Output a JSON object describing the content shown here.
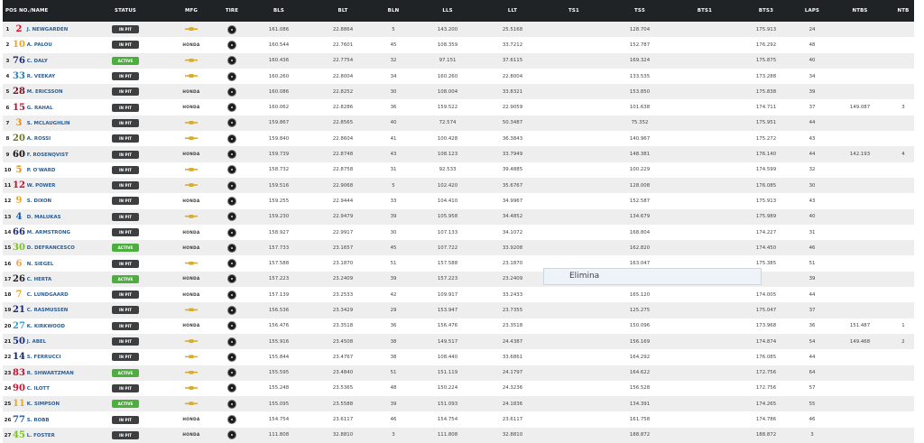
{
  "columns": [
    {
      "key": "pos_name",
      "label": "POS NO./NAME"
    },
    {
      "key": "status",
      "label": "STATUS"
    },
    {
      "key": "mfg",
      "label": "MFG"
    },
    {
      "key": "tire",
      "label": "TIRE"
    },
    {
      "key": "bls",
      "label": "BLS"
    },
    {
      "key": "blt",
      "label": "BLT"
    },
    {
      "key": "bln",
      "label": "BLN"
    },
    {
      "key": "lls",
      "label": "LLS"
    },
    {
      "key": "llt",
      "label": "LLT"
    },
    {
      "key": "ts1",
      "label": "TS1"
    },
    {
      "key": "ts5",
      "label": "TS5"
    },
    {
      "key": "bts1",
      "label": "BTS1"
    },
    {
      "key": "bts3",
      "label": "BTS3"
    },
    {
      "key": "laps",
      "label": "LAPS"
    },
    {
      "key": "ntbs",
      "label": "NTBS"
    },
    {
      "key": "ntb",
      "label": "NTB"
    }
  ],
  "car_number_colors": {
    "1": "#c8102e",
    "2": "#e9a820",
    "3": "#1a2c78",
    "4": "#2a7fb0",
    "5": "#7a1020",
    "6": "#c8102e",
    "7": "#e38c1b",
    "8": "#6b7a1e",
    "9": "#111111",
    "10": "#e38c1b",
    "11": "#c8102e",
    "12": "#e9a820",
    "13": "#1a5fa8",
    "14": "#1a2c78",
    "15": "#7bbf2a",
    "16": "#f0a35a",
    "17": "#222222",
    "18": "#e9a820",
    "19": "#1a2c78",
    "20": "#2aa7c2",
    "21": "#1a2c78",
    "22": "#0a2a6c",
    "23": "#c8102e",
    "24": "#c8102e",
    "25": "#e9a820",
    "26": "#1a5fa8",
    "27": "#7bbf2a"
  },
  "rows": [
    {
      "pos": "1",
      "num": "2",
      "name": "J. NEWGARDEN",
      "status": "IN PIT",
      "mfg": "chevrolet",
      "bls": "161.086",
      "blt": "22.8864",
      "bln": "5",
      "lls": "143.200",
      "llt": "25.5168",
      "ts1": "",
      "ts5": "128.704",
      "bts1": "",
      "bts3": "175.913",
      "laps": "24",
      "ntbs": "",
      "ntb": ""
    },
    {
      "pos": "2",
      "num": "10",
      "name": "A. PALOU",
      "status": "IN PIT",
      "mfg": "HONDA",
      "bls": "160.544",
      "blt": "22.7601",
      "bln": "45",
      "lls": "108.359",
      "llt": "33.7212",
      "ts1": "",
      "ts5": "152.787",
      "bts1": "",
      "bts3": "176.292",
      "laps": "48",
      "ntbs": "",
      "ntb": ""
    },
    {
      "pos": "3",
      "num": "76",
      "name": "C. DALY",
      "status": "ACTIVE",
      "mfg": "chevrolet",
      "bls": "160.436",
      "blt": "22.7754",
      "bln": "32",
      "lls": "97.151",
      "llt": "37.6115",
      "ts1": "",
      "ts5": "169.324",
      "bts1": "",
      "bts3": "175.875",
      "laps": "40",
      "ntbs": "",
      "ntb": ""
    },
    {
      "pos": "4",
      "num": "33",
      "name": "R. VEEKAY",
      "status": "IN PIT",
      "mfg": "chevrolet",
      "bls": "160.260",
      "blt": "22.8004",
      "bln": "34",
      "lls": "160.260",
      "llt": "22.8004",
      "ts1": "",
      "ts5": "133.535",
      "bts1": "",
      "bts3": "173.288",
      "laps": "34",
      "ntbs": "",
      "ntb": ""
    },
    {
      "pos": "5",
      "num": "28",
      "name": "M. ERICSSON",
      "status": "IN PIT",
      "mfg": "HONDA",
      "bls": "160.086",
      "blt": "22.8252",
      "bln": "30",
      "lls": "108.004",
      "llt": "33.8321",
      "ts1": "",
      "ts5": "153.850",
      "bts1": "",
      "bts3": "175.838",
      "laps": "39",
      "ntbs": "",
      "ntb": ""
    },
    {
      "pos": "6",
      "num": "15",
      "name": "G. RAHAL",
      "status": "IN PIT",
      "mfg": "HONDA",
      "bls": "160.062",
      "blt": "22.8286",
      "bln": "36",
      "lls": "159.522",
      "llt": "22.9059",
      "ts1": "",
      "ts5": "101.638",
      "bts1": "",
      "bts3": "174.711",
      "laps": "37",
      "ntbs": "149.087",
      "ntb": "3"
    },
    {
      "pos": "7",
      "num": "3",
      "name": "S. MCLAUGHLIN",
      "status": "IN PIT",
      "mfg": "chevrolet",
      "bls": "159.867",
      "blt": "22.8565",
      "bln": "40",
      "lls": "72.574",
      "llt": "50.3487",
      "ts1": "",
      "ts5": "75.352",
      "bts1": "",
      "bts3": "175.951",
      "laps": "44",
      "ntbs": "",
      "ntb": ""
    },
    {
      "pos": "8",
      "num": "20",
      "name": "A. ROSSI",
      "status": "IN PIT",
      "mfg": "chevrolet",
      "bls": "159.840",
      "blt": "22.8604",
      "bln": "41",
      "lls": "100.428",
      "llt": "36.3843",
      "ts1": "",
      "ts5": "140.967",
      "bts1": "",
      "bts3": "175.272",
      "laps": "43",
      "ntbs": "",
      "ntb": ""
    },
    {
      "pos": "9",
      "num": "60",
      "name": "F. ROSENQVIST",
      "status": "IN PIT",
      "mfg": "HONDA",
      "bls": "159.739",
      "blt": "22.8748",
      "bln": "43",
      "lls": "108.123",
      "llt": "33.7949",
      "ts1": "",
      "ts5": "148.381",
      "bts1": "",
      "bts3": "176.140",
      "laps": "44",
      "ntbs": "142.193",
      "ntb": "4"
    },
    {
      "pos": "10",
      "num": "5",
      "name": "P. O'WARD",
      "status": "IN PIT",
      "mfg": "chevrolet",
      "bls": "158.732",
      "blt": "22.8758",
      "bln": "31",
      "lls": "92.533",
      "llt": "39.4885",
      "ts1": "",
      "ts5": "100.229",
      "bts1": "",
      "bts3": "174.599",
      "laps": "32",
      "ntbs": "",
      "ntb": ""
    },
    {
      "pos": "11",
      "num": "12",
      "name": "W. POWER",
      "status": "IN PIT",
      "mfg": "chevrolet",
      "bls": "159.516",
      "blt": "22.9068",
      "bln": "5",
      "lls": "102.420",
      "llt": "35.6767",
      "ts1": "",
      "ts5": "128.008",
      "bts1": "",
      "bts3": "176.085",
      "laps": "30",
      "ntbs": "",
      "ntb": ""
    },
    {
      "pos": "12",
      "num": "9",
      "name": "S. DIXON",
      "status": "IN PIT",
      "mfg": "HONDA",
      "bls": "159.255",
      "blt": "22.9444",
      "bln": "33",
      "lls": "104.410",
      "llt": "34.9967",
      "ts1": "",
      "ts5": "152.587",
      "bts1": "",
      "bts3": "175.913",
      "laps": "43",
      "ntbs": "",
      "ntb": ""
    },
    {
      "pos": "13",
      "num": "4",
      "name": "D. MALUKAS",
      "status": "IN PIT",
      "mfg": "chevrolet",
      "bls": "159.230",
      "blt": "22.9479",
      "bln": "39",
      "lls": "105.958",
      "llt": "34.4852",
      "ts1": "",
      "ts5": "134.679",
      "bts1": "",
      "bts3": "175.989",
      "laps": "40",
      "ntbs": "",
      "ntb": ""
    },
    {
      "pos": "14",
      "num": "66",
      "name": "M. ARMSTRONG",
      "status": "IN PIT",
      "mfg": "HONDA",
      "bls": "158.927",
      "blt": "22.9917",
      "bln": "30",
      "lls": "107.133",
      "llt": "34.1072",
      "ts1": "",
      "ts5": "168.804",
      "bts1": "",
      "bts3": "174.227",
      "laps": "31",
      "ntbs": "",
      "ntb": ""
    },
    {
      "pos": "15",
      "num": "30",
      "name": "D. DEFRANCESCO",
      "status": "ACTIVE",
      "mfg": "HONDA",
      "bls": "157.733",
      "blt": "23.1657",
      "bln": "45",
      "lls": "107.722",
      "llt": "33.9208",
      "ts1": "",
      "ts5": "162.820",
      "bts1": "",
      "bts3": "174.450",
      "laps": "46",
      "ntbs": "",
      "ntb": ""
    },
    {
      "pos": "16",
      "num": "6",
      "name": "N. SIEGEL",
      "status": "IN PIT",
      "mfg": "chevrolet",
      "bls": "157.588",
      "blt": "23.1870",
      "bln": "51",
      "lls": "157.588",
      "llt": "23.1870",
      "ts1": "",
      "ts5": "163.047",
      "bts1": "",
      "bts3": "175.385",
      "laps": "51",
      "ntbs": "",
      "ntb": ""
    },
    {
      "pos": "17",
      "num": "26",
      "name": "C. HERTA",
      "status": "ACTIVE",
      "mfg": "HONDA",
      "bls": "157.223",
      "blt": "23.2409",
      "bln": "39",
      "lls": "157.223",
      "llt": "23.2409",
      "ts1": "",
      "ts5": "",
      "bts1": "",
      "bts3": "",
      "laps": "39",
      "ntbs": "",
      "ntb": ""
    },
    {
      "pos": "18",
      "num": "7",
      "name": "C. LUNDGAARD",
      "status": "IN PIT",
      "mfg": "HONDA",
      "bls": "157.139",
      "blt": "23.2533",
      "bln": "42",
      "lls": "109.917",
      "llt": "33.2433",
      "ts1": "",
      "ts5": "165.120",
      "bts1": "",
      "bts3": "174.005",
      "laps": "44",
      "ntbs": "",
      "ntb": ""
    },
    {
      "pos": "19",
      "num": "21",
      "name": "C. RASMUSSEN",
      "status": "IN PIT",
      "mfg": "chevrolet",
      "bls": "156.536",
      "blt": "23.3429",
      "bln": "29",
      "lls": "153.947",
      "llt": "23.7355",
      "ts1": "",
      "ts5": "125.275",
      "bts1": "",
      "bts3": "175.047",
      "laps": "37",
      "ntbs": "",
      "ntb": ""
    },
    {
      "pos": "20",
      "num": "27",
      "name": "K. KIRKWOOD",
      "status": "IN PIT",
      "mfg": "HONDA",
      "bls": "156.476",
      "blt": "23.3518",
      "bln": "36",
      "lls": "156.476",
      "llt": "23.3518",
      "ts1": "",
      "ts5": "150.096",
      "bts1": "",
      "bts3": "173.968",
      "laps": "36",
      "ntbs": "151.487",
      "ntb": "1"
    },
    {
      "pos": "21",
      "num": "50",
      "name": "J. ABEL",
      "status": "IN PIT",
      "mfg": "chevrolet",
      "bls": "155.916",
      "blt": "23.4508",
      "bln": "38",
      "lls": "149.517",
      "llt": "24.4387",
      "ts1": "",
      "ts5": "156.169",
      "bts1": "",
      "bts3": "174.874",
      "laps": "54",
      "ntbs": "149.468",
      "ntb": "2"
    },
    {
      "pos": "22",
      "num": "14",
      "name": "S. FERRUCCI",
      "status": "IN PIT",
      "mfg": "chevrolet",
      "bls": "155.844",
      "blt": "23.4767",
      "bln": "38",
      "lls": "108.440",
      "llt": "33.6861",
      "ts1": "",
      "ts5": "164.292",
      "bts1": "",
      "bts3": "176.085",
      "laps": "44",
      "ntbs": "",
      "ntb": ""
    },
    {
      "pos": "23",
      "num": "83",
      "name": "R. SHWARTZMAN",
      "status": "ACTIVE",
      "mfg": "chevrolet",
      "bls": "155.595",
      "blt": "23.4840",
      "bln": "51",
      "lls": "151.119",
      "llt": "24.1797",
      "ts1": "",
      "ts5": "164.622",
      "bts1": "",
      "bts3": "172.756",
      "laps": "64",
      "ntbs": "",
      "ntb": ""
    },
    {
      "pos": "24",
      "num": "90",
      "name": "C. ILOTT",
      "status": "IN PIT",
      "mfg": "chevrolet",
      "bls": "155.248",
      "blt": "23.5365",
      "bln": "48",
      "lls": "150.224",
      "llt": "24.3236",
      "ts1": "",
      "ts5": "156.528",
      "bts1": "",
      "bts3": "172.756",
      "laps": "57",
      "ntbs": "",
      "ntb": ""
    },
    {
      "pos": "25",
      "num": "11",
      "name": "K. SIMPSON",
      "status": "ACTIVE",
      "mfg": "chevrolet",
      "bls": "155.095",
      "blt": "23.5588",
      "bln": "39",
      "lls": "151.093",
      "llt": "24.1836",
      "ts1": "",
      "ts5": "134.391",
      "bts1": "",
      "bts3": "174.265",
      "laps": "55",
      "ntbs": "",
      "ntb": ""
    },
    {
      "pos": "26",
      "num": "77",
      "name": "S. ROBB",
      "status": "IN PIT",
      "mfg": "HONDA",
      "bls": "154.754",
      "blt": "23.6117",
      "bln": "46",
      "lls": "154.754",
      "llt": "23.6117",
      "ts1": "",
      "ts5": "161.758",
      "bts1": "",
      "bts3": "174.786",
      "laps": "46",
      "ntbs": "",
      "ntb": ""
    },
    {
      "pos": "27",
      "num": "45",
      "name": "L. FOSTER",
      "status": "IN PIT",
      "mfg": "HONDA",
      "bls": "111.808",
      "blt": "32.8810",
      "bln": "3",
      "lls": "111.808",
      "llt": "32.8810",
      "ts1": "",
      "ts5": "188.872",
      "bts1": "",
      "bts3": "188.872",
      "laps": "3",
      "ntbs": "",
      "ntb": ""
    }
  ],
  "tooltip": {
    "label": "Elimina"
  }
}
